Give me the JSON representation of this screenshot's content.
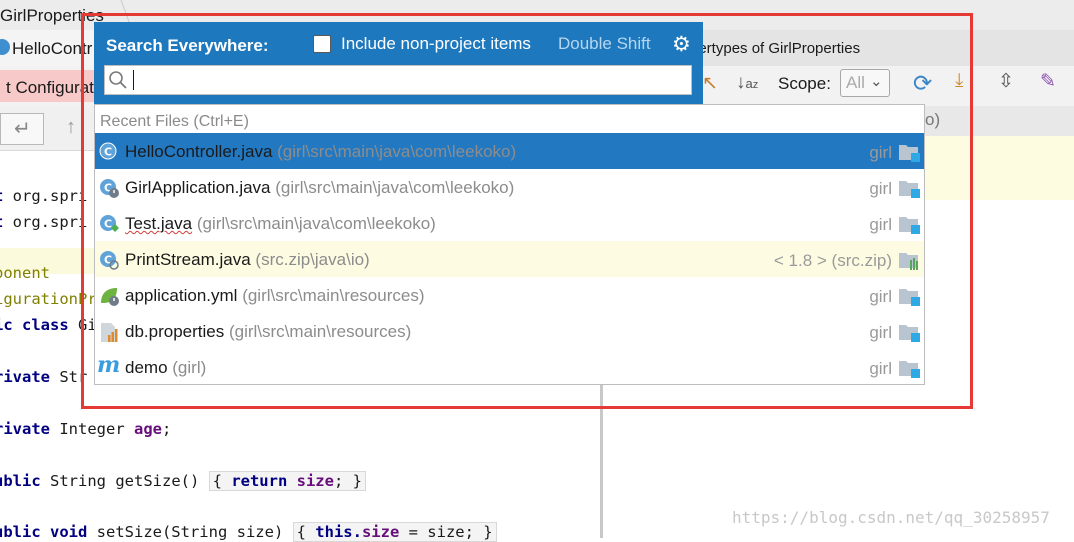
{
  "ide": {
    "breadcrumb": "GirlProperties",
    "editor_tab": "HelloContr",
    "config_label": "t Configurati",
    "hierarchy_title": "pertypes of GirlProperties",
    "scope_label": "Scope:",
    "scope_value": "All",
    "hierarchy_paren": "o)",
    "code_lines": [
      {
        "a": "t ",
        "b": "org.spri"
      },
      {
        "a": "t ",
        "b": "org.spri"
      },
      {
        "ann": "ponent"
      },
      {
        "ann": "igurationPr"
      },
      {
        "k": "ic class ",
        "t": "Gi"
      },
      {
        "k": "rivate ",
        "t": "Str"
      },
      {
        "k": "rivate ",
        "t": "Integer ",
        "f": "age",
        ";": ";"
      },
      {
        "k": "ublic ",
        "t": "String getSize() ",
        "b1": "{ ",
        "k2": "return ",
        "f": "size",
        ";": "; ",
        "b2": "}"
      },
      {
        "k": "ublic void ",
        "t": "setSize(String size) ",
        "b1": "{ ",
        "k2": "this.",
        "f": "size",
        ";": " = size; ",
        "b2": "}"
      }
    ],
    "watermark": "https://blog.csdn.net/qq_30258957"
  },
  "search_popup": {
    "title": "Search Everywhere:",
    "checkbox_label": "Include non-project items",
    "checkbox_checked": false,
    "shortcut_hint": "Double Shift",
    "search_value": "",
    "section_label": "Recent Files (Ctrl+E)",
    "items": [
      {
        "name": "HelloController.java",
        "path": "(girl\\src\\main\\java\\com\\leekoko)",
        "module": "girl",
        "icon": "java-class-icon",
        "selected": true
      },
      {
        "name": "GirlApplication.java",
        "path": "(girl\\src\\main\\java\\com\\leekoko)",
        "module": "girl",
        "icon": "spring-boot-app-icon",
        "selected": false
      },
      {
        "name": "Test.java",
        "path": "(girl\\src\\main\\java\\com\\leekoko)",
        "module": "girl",
        "icon": "java-test-class-icon",
        "selected": false
      },
      {
        "name": "PrintStream.java",
        "path": "(src.zip\\java\\io)",
        "module": "< 1.8 > (src.zip)",
        "icon": "java-library-class-icon",
        "selected": false
      },
      {
        "name": "application.yml",
        "path": "(girl\\src\\main\\resources)",
        "module": "girl",
        "icon": "spring-config-icon",
        "selected": false
      },
      {
        "name": "db.properties",
        "path": "(girl\\src\\main\\resources)",
        "module": "girl",
        "icon": "properties-file-icon",
        "selected": false
      },
      {
        "name": "demo",
        "path": "(girl)",
        "module": "girl",
        "icon": "maven-module-icon",
        "selected": false
      }
    ]
  },
  "colors": {
    "popup_header": "#1d78bd",
    "selection": "#2279c2",
    "highlight_border": "#e53935"
  }
}
